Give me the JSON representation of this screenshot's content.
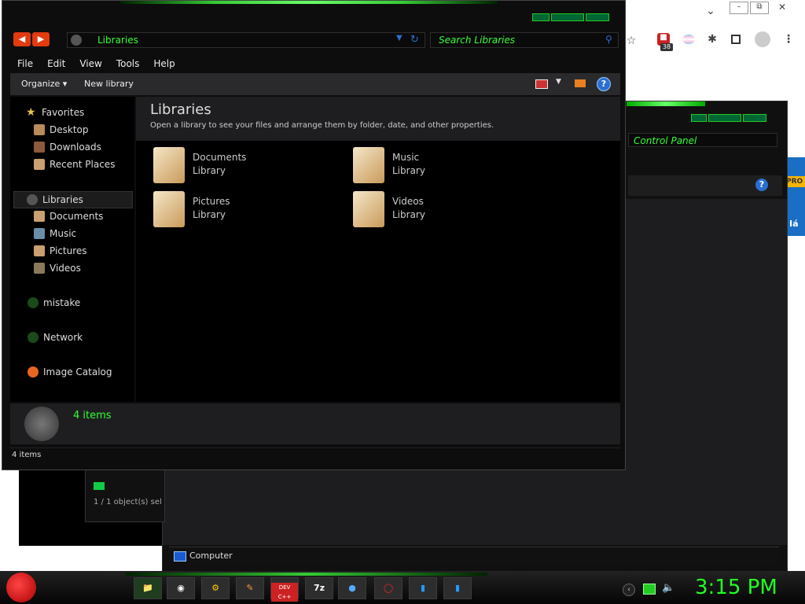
{
  "browser": {
    "icons": [
      "chevron-down-icon",
      "minimize-icon",
      "restore-icon",
      "close-icon",
      "star-icon",
      "shield-extension-icon",
      "gender-extension-icon",
      "puzzle-icon",
      "sidepanel-icon",
      "profile-icon",
      "kebab-menu-icon"
    ],
    "badge_count": "38",
    "side_label": "PRO",
    "side_text": "Iá"
  },
  "background_window": {
    "search_placeholder": "Control Panel",
    "status": "Computer"
  },
  "small_window": {
    "status": "1 / 1 object(s) sel"
  },
  "window": {
    "address": "Libraries",
    "search_placeholder": "Search Libraries",
    "menu": [
      "File",
      "Edit",
      "View",
      "Tools",
      "Help"
    ],
    "toolbar": {
      "organize": "Organize",
      "new_library": "New library"
    },
    "nav": {
      "favorites": "Favorites",
      "desktop": "Desktop",
      "downloads": "Downloads",
      "recent": "Recent Places",
      "libraries": "Libraries",
      "documents": "Documents",
      "music": "Music",
      "pictures": "Pictures",
      "videos": "Videos",
      "mistake": "mistake",
      "network": "Network",
      "catalog": "Image Catalog"
    },
    "content": {
      "title": "Libraries",
      "subtitle": "Open a library to see your files and arrange them by folder, date, and other properties.",
      "libs": [
        {
          "name": "Documents",
          "type": "Library"
        },
        {
          "name": "Music",
          "type": "Library"
        },
        {
          "name": "Pictures",
          "type": "Library"
        },
        {
          "name": "Videos",
          "type": "Library"
        }
      ]
    },
    "details": "4 items",
    "status": "4 items"
  },
  "taskbar": {
    "apps": [
      "DEV C++",
      "7z"
    ],
    "clock": "3:15 PM"
  },
  "colors": {
    "accent": "#33ff33",
    "window_bg": "#0d0d0d",
    "nav_btn": "#e33a10"
  }
}
